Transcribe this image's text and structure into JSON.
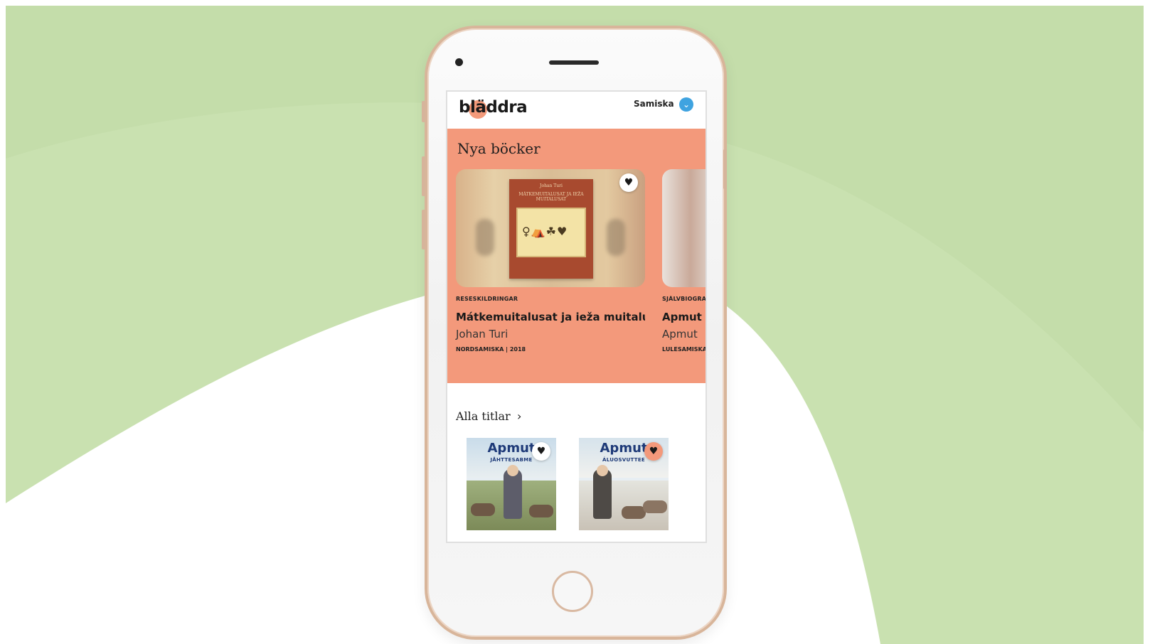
{
  "app": {
    "logo_text": "bläddra",
    "language_label": "Samiska",
    "language_chevron_icon": "chevron-down-icon",
    "accent_color": "#f3997b",
    "link_color": "#3fa3e0"
  },
  "new_books": {
    "heading": "Nya böcker",
    "items": [
      {
        "category": "RESESKILDRINGAR",
        "title": "Mátkemuitalusat ja ieža muitalusat",
        "author": "Johan Turi",
        "lang_year": "NORDSAMISKA | 2018",
        "cover_author": "Johan Turi",
        "cover_title": "MÁTKEMUITALUSAT JA IEŽA MUITALUSAT",
        "favorite_icon": "heart-icon"
      },
      {
        "category": "SJÄLVBIOGRAFI",
        "title": "Apmut",
        "author": "Apmut",
        "lang_year": "LULESAMISKA",
        "favorite_icon": "heart-icon"
      }
    ]
  },
  "all_titles": {
    "heading": "Alla titlar",
    "arrow_icon": "chevron-right-icon",
    "items": [
      {
        "title": "Apmut",
        "subtitle": "JÅHTTESABME",
        "favorite_icon": "heart-icon",
        "favorited": false
      },
      {
        "title": "Apmut",
        "subtitle": "ÁLUOSVUTTEE",
        "favorite_icon": "heart-icon",
        "favorited": true
      }
    ]
  }
}
